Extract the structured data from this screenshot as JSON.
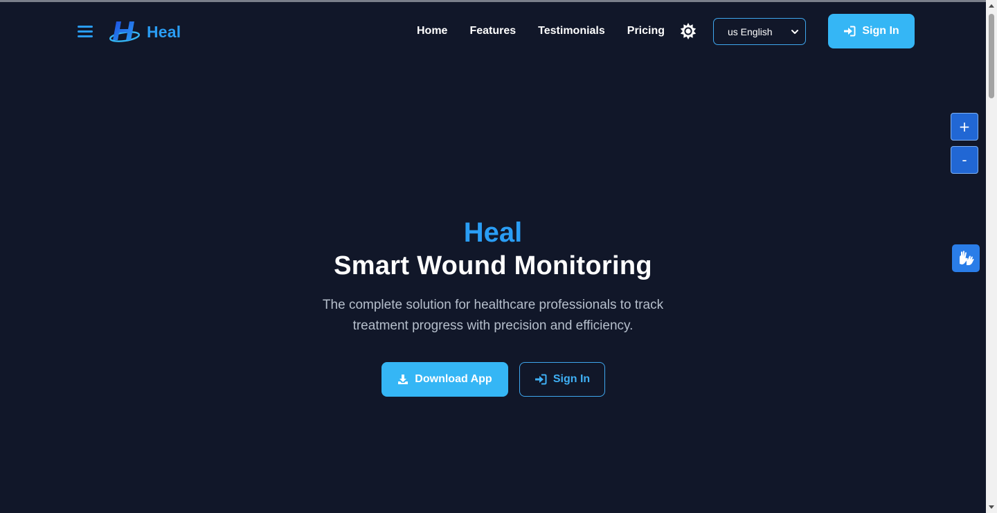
{
  "header": {
    "brand": "Heal",
    "nav": [
      "Home",
      "Features",
      "Testimonials",
      "Pricing"
    ],
    "language": {
      "selected": "us English"
    },
    "signin_label": "Sign In"
  },
  "floating": {
    "zoom_in": "+",
    "zoom_out": "-"
  },
  "hero": {
    "brand": "Heal",
    "title": "Smart Wound Monitoring",
    "subtitle": "The complete solution for healthcare professionals to track treatment progress with precision and efficiency.",
    "download_label": "Download App",
    "signin_label": "Sign In"
  },
  "colors": {
    "background": "#111729",
    "accent": "#2a9df4",
    "button": "#35b6f5",
    "zoom_button": "#2167d4"
  },
  "icons": [
    "menu-icon",
    "heal-logo-icon",
    "sun-icon",
    "chevron-down-icon",
    "sign-in-icon",
    "download-icon",
    "sign-language-icon"
  ]
}
